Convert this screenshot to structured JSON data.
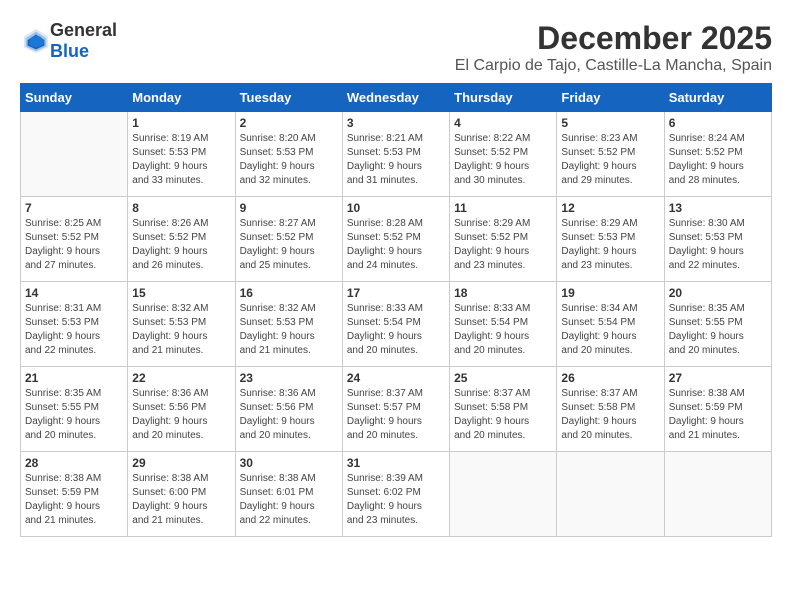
{
  "logo": {
    "general": "General",
    "blue": "Blue"
  },
  "title": "December 2025",
  "subtitle": "El Carpio de Tajo, Castille-La Mancha, Spain",
  "headers": [
    "Sunday",
    "Monday",
    "Tuesday",
    "Wednesday",
    "Thursday",
    "Friday",
    "Saturday"
  ],
  "weeks": [
    [
      {
        "day": "",
        "info": ""
      },
      {
        "day": "1",
        "info": "Sunrise: 8:19 AM\nSunset: 5:53 PM\nDaylight: 9 hours\nand 33 minutes."
      },
      {
        "day": "2",
        "info": "Sunrise: 8:20 AM\nSunset: 5:53 PM\nDaylight: 9 hours\nand 32 minutes."
      },
      {
        "day": "3",
        "info": "Sunrise: 8:21 AM\nSunset: 5:53 PM\nDaylight: 9 hours\nand 31 minutes."
      },
      {
        "day": "4",
        "info": "Sunrise: 8:22 AM\nSunset: 5:52 PM\nDaylight: 9 hours\nand 30 minutes."
      },
      {
        "day": "5",
        "info": "Sunrise: 8:23 AM\nSunset: 5:52 PM\nDaylight: 9 hours\nand 29 minutes."
      },
      {
        "day": "6",
        "info": "Sunrise: 8:24 AM\nSunset: 5:52 PM\nDaylight: 9 hours\nand 28 minutes."
      }
    ],
    [
      {
        "day": "7",
        "info": "Sunrise: 8:25 AM\nSunset: 5:52 PM\nDaylight: 9 hours\nand 27 minutes."
      },
      {
        "day": "8",
        "info": "Sunrise: 8:26 AM\nSunset: 5:52 PM\nDaylight: 9 hours\nand 26 minutes."
      },
      {
        "day": "9",
        "info": "Sunrise: 8:27 AM\nSunset: 5:52 PM\nDaylight: 9 hours\nand 25 minutes."
      },
      {
        "day": "10",
        "info": "Sunrise: 8:28 AM\nSunset: 5:52 PM\nDaylight: 9 hours\nand 24 minutes."
      },
      {
        "day": "11",
        "info": "Sunrise: 8:29 AM\nSunset: 5:52 PM\nDaylight: 9 hours\nand 23 minutes."
      },
      {
        "day": "12",
        "info": "Sunrise: 8:29 AM\nSunset: 5:53 PM\nDaylight: 9 hours\nand 23 minutes."
      },
      {
        "day": "13",
        "info": "Sunrise: 8:30 AM\nSunset: 5:53 PM\nDaylight: 9 hours\nand 22 minutes."
      }
    ],
    [
      {
        "day": "14",
        "info": "Sunrise: 8:31 AM\nSunset: 5:53 PM\nDaylight: 9 hours\nand 22 minutes."
      },
      {
        "day": "15",
        "info": "Sunrise: 8:32 AM\nSunset: 5:53 PM\nDaylight: 9 hours\nand 21 minutes."
      },
      {
        "day": "16",
        "info": "Sunrise: 8:32 AM\nSunset: 5:53 PM\nDaylight: 9 hours\nand 21 minutes."
      },
      {
        "day": "17",
        "info": "Sunrise: 8:33 AM\nSunset: 5:54 PM\nDaylight: 9 hours\nand 20 minutes."
      },
      {
        "day": "18",
        "info": "Sunrise: 8:33 AM\nSunset: 5:54 PM\nDaylight: 9 hours\nand 20 minutes."
      },
      {
        "day": "19",
        "info": "Sunrise: 8:34 AM\nSunset: 5:54 PM\nDaylight: 9 hours\nand 20 minutes."
      },
      {
        "day": "20",
        "info": "Sunrise: 8:35 AM\nSunset: 5:55 PM\nDaylight: 9 hours\nand 20 minutes."
      }
    ],
    [
      {
        "day": "21",
        "info": "Sunrise: 8:35 AM\nSunset: 5:55 PM\nDaylight: 9 hours\nand 20 minutes."
      },
      {
        "day": "22",
        "info": "Sunrise: 8:36 AM\nSunset: 5:56 PM\nDaylight: 9 hours\nand 20 minutes."
      },
      {
        "day": "23",
        "info": "Sunrise: 8:36 AM\nSunset: 5:56 PM\nDaylight: 9 hours\nand 20 minutes."
      },
      {
        "day": "24",
        "info": "Sunrise: 8:37 AM\nSunset: 5:57 PM\nDaylight: 9 hours\nand 20 minutes."
      },
      {
        "day": "25",
        "info": "Sunrise: 8:37 AM\nSunset: 5:58 PM\nDaylight: 9 hours\nand 20 minutes."
      },
      {
        "day": "26",
        "info": "Sunrise: 8:37 AM\nSunset: 5:58 PM\nDaylight: 9 hours\nand 20 minutes."
      },
      {
        "day": "27",
        "info": "Sunrise: 8:38 AM\nSunset: 5:59 PM\nDaylight: 9 hours\nand 21 minutes."
      }
    ],
    [
      {
        "day": "28",
        "info": "Sunrise: 8:38 AM\nSunset: 5:59 PM\nDaylight: 9 hours\nand 21 minutes."
      },
      {
        "day": "29",
        "info": "Sunrise: 8:38 AM\nSunset: 6:00 PM\nDaylight: 9 hours\nand 21 minutes."
      },
      {
        "day": "30",
        "info": "Sunrise: 8:38 AM\nSunset: 6:01 PM\nDaylight: 9 hours\nand 22 minutes."
      },
      {
        "day": "31",
        "info": "Sunrise: 8:39 AM\nSunset: 6:02 PM\nDaylight: 9 hours\nand 23 minutes."
      },
      {
        "day": "",
        "info": ""
      },
      {
        "day": "",
        "info": ""
      },
      {
        "day": "",
        "info": ""
      }
    ]
  ]
}
